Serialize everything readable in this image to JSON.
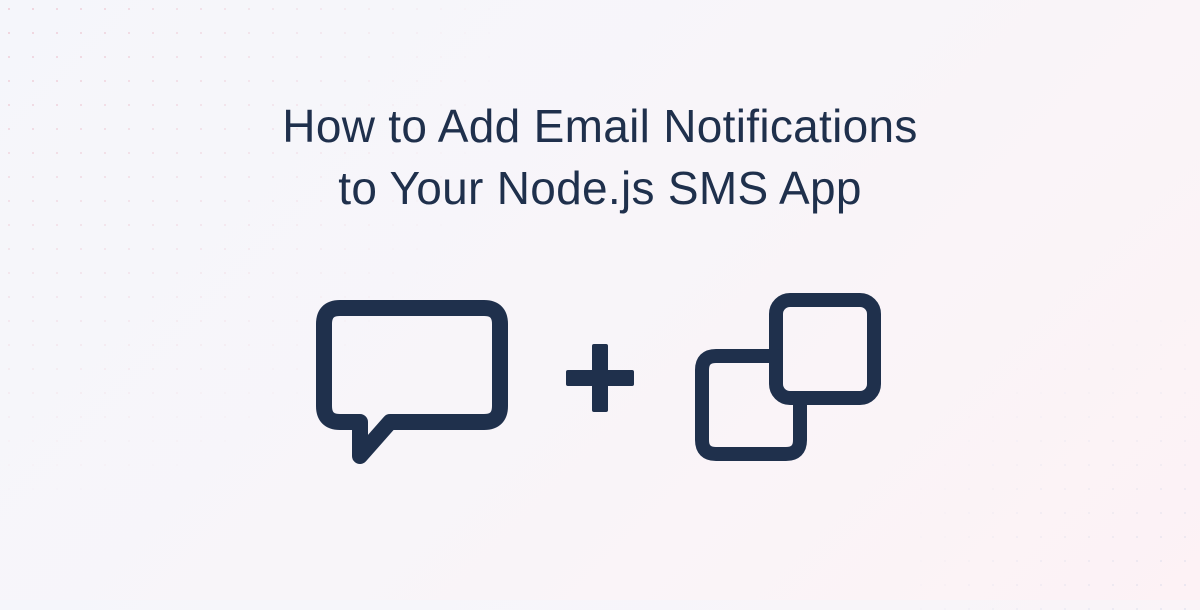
{
  "title": {
    "line1": "How to Add Email Notifications",
    "line2": "to Your Node.js SMS App"
  },
  "colors": {
    "text": "#1f304c",
    "icon": "#1f304c",
    "dotRed": "#e8a5b5",
    "dotBlue": "#b8c5e0"
  },
  "icons": {
    "left": "chat-bubble",
    "middle": "plus",
    "right": "overlapping-squares"
  }
}
